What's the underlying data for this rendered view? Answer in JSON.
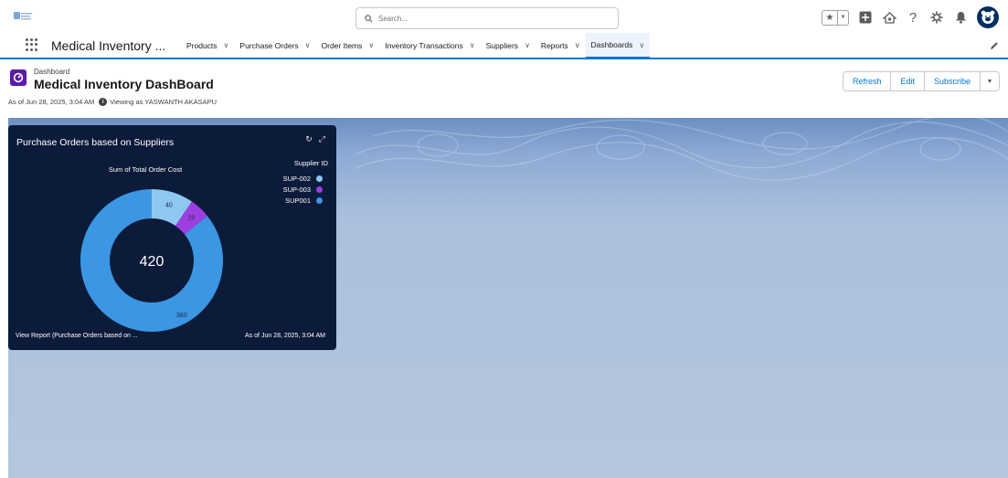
{
  "header": {
    "search_placeholder": "Search..."
  },
  "nav": {
    "app_name": "Medical Inventory ...",
    "items": [
      {
        "label": "Products"
      },
      {
        "label": "Purchase Orders"
      },
      {
        "label": "Order Items"
      },
      {
        "label": "Inventory Transactions"
      },
      {
        "label": "Suppliers"
      },
      {
        "label": "Reports"
      },
      {
        "label": "Dashboards",
        "active": true
      }
    ]
  },
  "dashboard": {
    "breadcrumb": "Dashboard",
    "title": "Medical Inventory DashBoard",
    "as_of": "As of Jun 28, 2025, 3:04 AM",
    "viewing_as": "Viewing as YASWANTH AKASAPU",
    "buttons": {
      "refresh": "Refresh",
      "edit": "Edit",
      "subscribe": "Subscribe"
    }
  },
  "widget": {
    "title": "Purchase Orders based on Suppliers",
    "measure_label": "Sum of Total Order Cost",
    "total": "420",
    "footer_link": "View Report (Purchase Orders based on ...",
    "footer_time": "As of Jun 28, 2025, 3:04 AM"
  },
  "colors": {
    "sup002": "#8ec8f0",
    "sup003": "#9d3fe0",
    "sup001": "#3b97e3",
    "brand": "#0176d3"
  },
  "chart_data": {
    "type": "pie",
    "variant": "donut",
    "title": "Sum of Total Order Cost",
    "legend_title": "Supplier ID",
    "legend_position": "right",
    "center_label": "420",
    "categories": [
      "SUP-002",
      "SUP-003",
      "SUP001"
    ],
    "values": [
      40,
      20,
      360
    ]
  }
}
